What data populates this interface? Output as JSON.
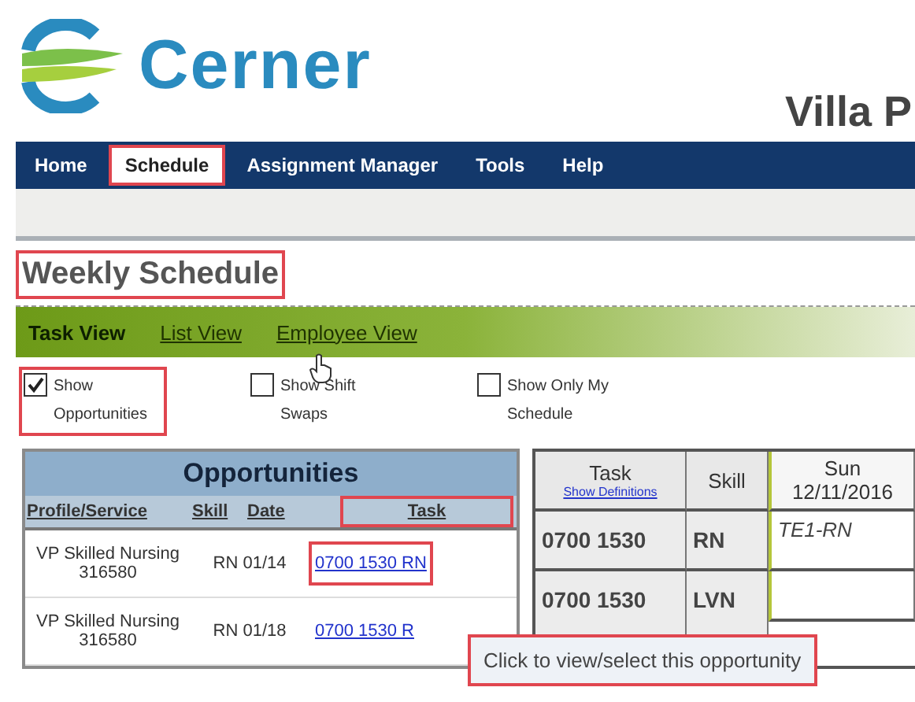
{
  "header": {
    "logo_text": "Cerner",
    "site_title": "Villa P"
  },
  "nav": [
    {
      "label": "Home",
      "selected": false,
      "highlighted": false
    },
    {
      "label": "Schedule",
      "selected": true,
      "highlighted": true
    },
    {
      "label": "Assignment Manager",
      "selected": false,
      "highlighted": false
    },
    {
      "label": "Tools",
      "selected": false,
      "highlighted": false
    },
    {
      "label": "Help",
      "selected": false,
      "highlighted": false
    }
  ],
  "page_title": {
    "text": "Weekly Schedule",
    "highlighted": true
  },
  "view_tabs": [
    {
      "label": "Task View",
      "selected": true
    },
    {
      "label": "List View",
      "selected": false
    },
    {
      "label": "Employee View",
      "selected": false
    }
  ],
  "options": [
    {
      "label": "Show Opportunities",
      "checked": true,
      "highlighted": true
    },
    {
      "label": "Show Shift Swaps",
      "checked": false,
      "highlighted": false
    },
    {
      "label": "Show Only My Schedule",
      "checked": false,
      "highlighted": false
    }
  ],
  "opportunities": {
    "title": "Opportunities",
    "columns": [
      {
        "label": "Profile/Service",
        "highlighted": false
      },
      {
        "label": "Skill",
        "highlighted": false
      },
      {
        "label": "Date",
        "highlighted": false
      },
      {
        "label": "Task",
        "highlighted": true
      }
    ],
    "rows": [
      {
        "profile": "VP Skilled Nursing 316580",
        "skill": "RN",
        "date": "01/14",
        "task": "0700 1530 RN",
        "highlighted": true
      },
      {
        "profile": "VP Skilled Nursing 316580",
        "skill": "RN",
        "date": "01/18",
        "task": "0700 1530 R",
        "highlighted": false
      }
    ]
  },
  "schedule": {
    "columns": [
      {
        "label": "Task",
        "link": "Show Definitions"
      },
      {
        "label": "Skill"
      },
      {
        "label": "Sun",
        "sub": "12/11/2016"
      }
    ],
    "rows": [
      {
        "task": "0700 1530",
        "skill": "RN",
        "sun": "TE1-RN"
      },
      {
        "task": "0700 1530",
        "skill": "LVN",
        "sun": ""
      }
    ]
  },
  "tooltip": {
    "text": "Click to view/select this opportunity",
    "highlighted": true
  }
}
